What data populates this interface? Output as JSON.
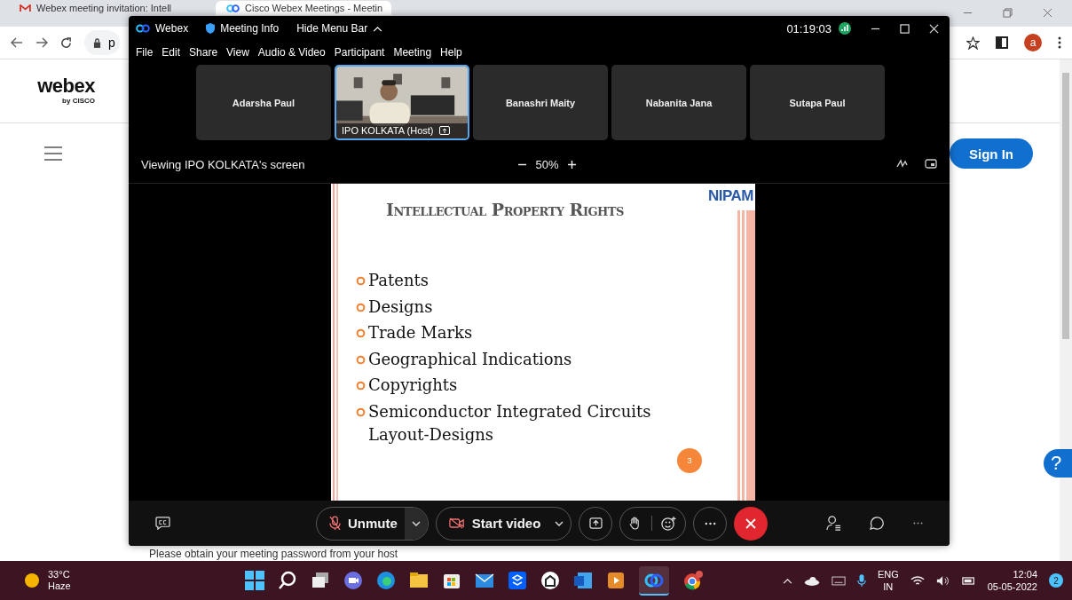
{
  "browser": {
    "tabs": [
      {
        "title": "Webex meeting invitation: Intell",
        "selected": false
      },
      {
        "title": "Cisco Webex Meetings - Meetin",
        "selected": true
      }
    ],
    "address": "p",
    "profile": "a",
    "page": {
      "logo": "webex",
      "logo_sub": "by CISCO",
      "sign_in": "Sign In",
      "help": "?",
      "notice": "Please obtain your meeting password from your host"
    }
  },
  "webex": {
    "app": "Webex",
    "meeting_info": "Meeting Info",
    "hide_menu": "Hide Menu Bar",
    "timer": "01:19:03",
    "menu": [
      "File",
      "Edit",
      "Share",
      "View",
      "Audio & Video",
      "Participant",
      "Meeting",
      "Help"
    ],
    "participants": [
      {
        "name": "Adarsha Paul",
        "kind": "avatar",
        "active": false
      },
      {
        "name": "IPO KOLKATA (Host)",
        "kind": "video",
        "active": true
      },
      {
        "name": "Banashri Maity",
        "kind": "avatar",
        "active": false
      },
      {
        "name": "Nabanita Jana",
        "kind": "avatar",
        "active": false
      },
      {
        "name": "Sutapa Paul",
        "kind": "avatar",
        "active": false
      }
    ],
    "viewing": "Viewing IPO KOLKATA's screen",
    "zoom": "50%",
    "slide": {
      "title": "Intellectual Property Rights",
      "logo": "NIPAM",
      "page": "3",
      "bullets": [
        "Patents",
        "Designs",
        "Trade Marks",
        "Geographical Indications",
        "Copyrights",
        "Semiconductor Integrated Circuits Layout-Designs"
      ]
    },
    "controls": {
      "unmute": "Unmute",
      "start_video": "Start video"
    }
  },
  "taskbar": {
    "temperature": "33°C",
    "weather": "Haze",
    "language": "ENG",
    "region": "IN",
    "time": "12:04",
    "date": "05-05-2022",
    "notifications": "2"
  }
}
